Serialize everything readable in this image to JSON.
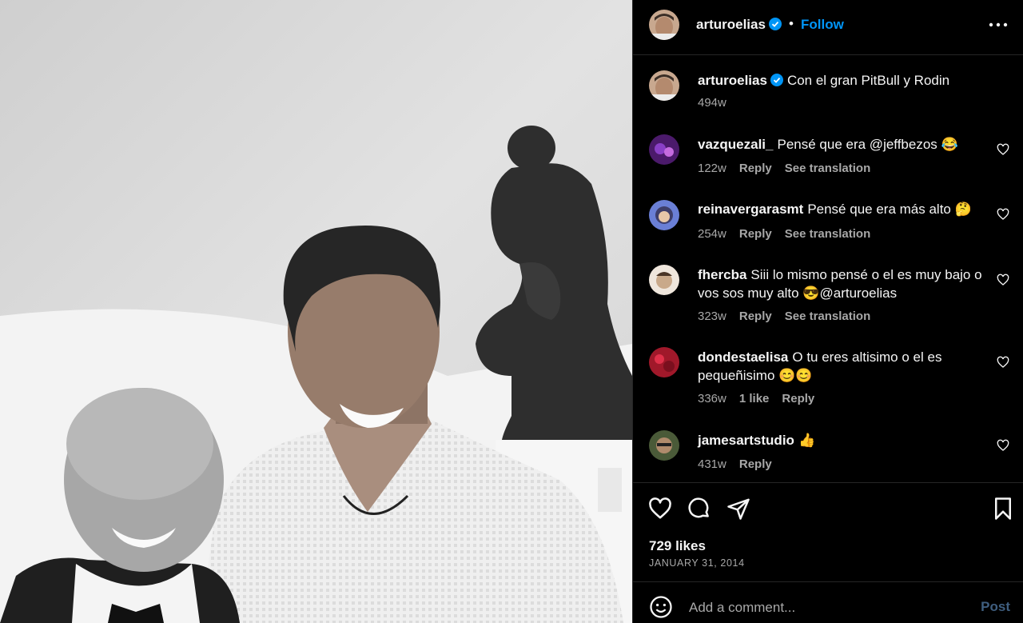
{
  "post": {
    "author": "arturoelias",
    "follow_label": "Follow",
    "dot": "•",
    "caption": "Con el gran PitBull y Rodin",
    "caption_time": "494w"
  },
  "comments": [
    {
      "user": "vazquezali_",
      "text": "Pensé que era @jeffbezos 😂",
      "time": "122w",
      "likes": "",
      "reply": "Reply",
      "translate": "See translation",
      "avatar_color": "#4b1a6b"
    },
    {
      "user": "reinavergarasmt",
      "text": "Pensé que era más alto 🤔",
      "time": "254w",
      "likes": "",
      "reply": "Reply",
      "translate": "See translation",
      "avatar_color": "#6a7fd6"
    },
    {
      "user": "fhercba",
      "text": "Siii lo mismo pensé o el es muy bajo o vos sos muy alto 😎@arturoelias",
      "time": "323w",
      "likes": "",
      "reply": "Reply",
      "translate": "See translation",
      "avatar_color": "#c9a98a"
    },
    {
      "user": "dondestaelisa",
      "text": "O tu eres altisimo o el es pequeñisimo 😊😊",
      "time": "336w",
      "likes": "1 like",
      "reply": "Reply",
      "translate": "",
      "avatar_color": "#a0182a"
    },
    {
      "user": "jamesartstudio",
      "text": "👍",
      "time": "431w",
      "likes": "",
      "reply": "Reply",
      "translate": "",
      "avatar_color": "#4a5a38"
    }
  ],
  "footer": {
    "likes": "729 likes",
    "date": "JANUARY 31, 2014",
    "comment_placeholder": "Add a comment...",
    "post_label": "Post"
  },
  "colors": {
    "accent": "#0095f6",
    "muted_text": "#a8a8a8",
    "post_disabled": "#3f5e7f"
  },
  "icons": [
    "verified-badge-icon",
    "more-options-icon",
    "heart-icon",
    "comment-icon",
    "share-icon",
    "bookmark-icon",
    "emoji-icon"
  ]
}
